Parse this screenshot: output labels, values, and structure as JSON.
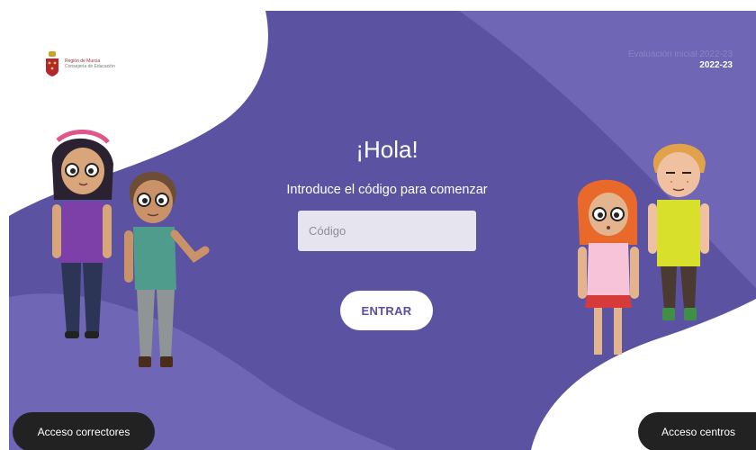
{
  "header": {
    "logo_line1": "Región de Murcia",
    "logo_line2": "Consejería de Educación",
    "eval_title": "Evaluación inicial 2022-23",
    "eval_year": "2022-23"
  },
  "main": {
    "greeting": "¡Hola!",
    "prompt": "Introduce el código para comenzar",
    "code_placeholder": "Código",
    "enter_label": "ENTRAR"
  },
  "footer": {
    "correctors_label": "Acceso correctores",
    "centers_label": "Acceso centros"
  },
  "colors": {
    "background_purple": "#5b53a2",
    "light_shape": "#7169b6",
    "white_shape": "#ffffff",
    "button_dark": "#222222",
    "input_bg": "#e6e5ef"
  }
}
